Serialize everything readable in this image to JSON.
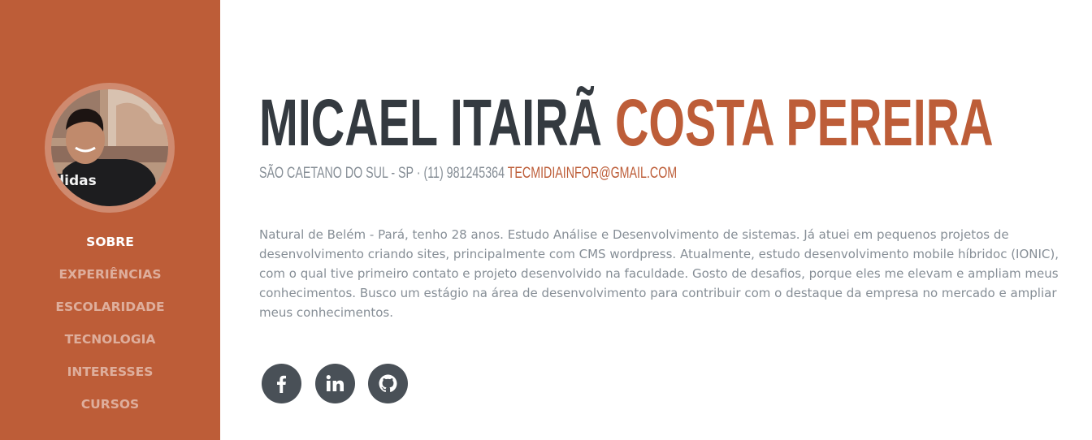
{
  "sidebar": {
    "avatar_icon": "profile-photo",
    "nav": [
      {
        "label": "SOBRE",
        "active": true
      },
      {
        "label": "EXPERIÊNCIAS",
        "active": false
      },
      {
        "label": "ESCOLARIDADE",
        "active": false
      },
      {
        "label": "TECNOLOGIA",
        "active": false
      },
      {
        "label": "INTERESSES",
        "active": false
      },
      {
        "label": "CURSOS",
        "active": false
      }
    ]
  },
  "profile": {
    "first_name": "MICAEL ITAIRÃ",
    "last_name": "COSTA PEREIRA",
    "contact_text": "SÃO CAETANO DO SUL - SP · (11) 981245364",
    "email": "TECMIDIAINFOR@GMAIL.COM",
    "bio": "Natural de Belém - Pará, tenho 28 anos. Estudo Análise e Desenvolvimento de sistemas. Já atuei em pequenos projetos de desenvolvimento criando sites, principalmente com CMS wordpress. Atualmente, estudo desenvolvimento mobile híbridoc (IONIC), com o qual tive primeiro contato e projeto desenvolvido na faculdade. Gosto de desafios, porque eles me elevam e ampliam meus conhecimentos. Busco um estágio na área de desenvolvimento para contribuir com o destaque da empresa no mercado e ampliar meus conhecimentos."
  },
  "social": [
    {
      "icon": "facebook-icon"
    },
    {
      "icon": "linkedin-icon"
    },
    {
      "icon": "github-icon"
    }
  ],
  "colors": {
    "primary": "#bd5d38",
    "dark": "#343a40",
    "muted": "#868e96",
    "social_bg": "#495057"
  }
}
